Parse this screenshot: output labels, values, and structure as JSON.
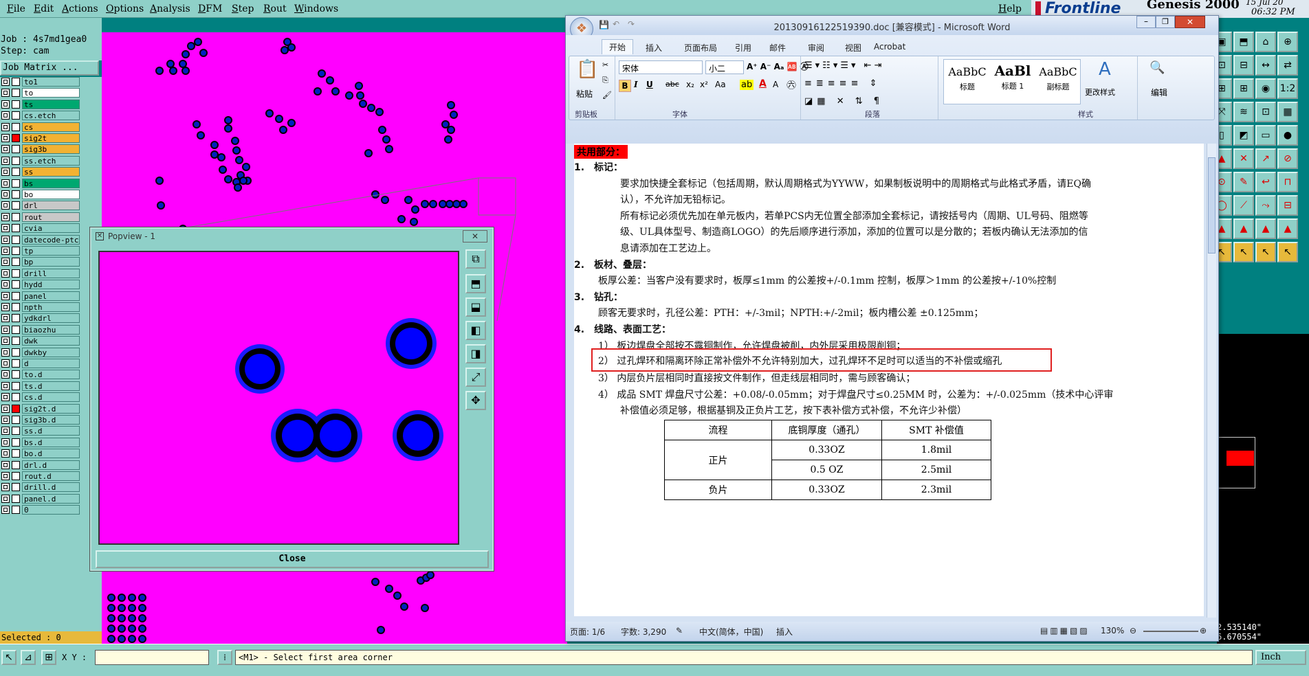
{
  "genesis": {
    "menu": [
      "File",
      "Edit",
      "Actions",
      "Options",
      "Analysis",
      "DFM",
      "Step",
      "Rout",
      "Windows"
    ],
    "help": "Help",
    "brand": "Frontline",
    "product": "Genesis 2000",
    "date": "15 Jul 20",
    "time": "06:32 PM",
    "job_label": "Job : 4s7md1gea0",
    "step_label": "Step: cam",
    "job_matrix": "Job Matrix ...",
    "selected": "Selected : 0",
    "coords": {
      "x": "2.535140\"",
      "y": "6.670554\""
    },
    "xy_label": "X Y :",
    "xy_value": "",
    "prompt": "<M1> - Select first area corner",
    "units": "Inch",
    "layers": [
      {
        "name": "to1",
        "color": "#8fd0c8",
        "sel": false
      },
      {
        "name": "to",
        "color": "#ffffff",
        "sel": false
      },
      {
        "name": "ts",
        "color": "#00a870",
        "sel": false
      },
      {
        "name": "cs.etch",
        "color": "#8fd0c8",
        "sel": false
      },
      {
        "name": "cs",
        "color": "#f2b233",
        "sel": false
      },
      {
        "name": "sig2t",
        "color": "#f2b233",
        "sel": true
      },
      {
        "name": "sig3b",
        "color": "#f2b233",
        "sel": false
      },
      {
        "name": "ss.etch",
        "color": "#8fd0c8",
        "sel": false
      },
      {
        "name": "ss",
        "color": "#f2b233",
        "sel": false
      },
      {
        "name": "bs",
        "color": "#00a870",
        "sel": false
      },
      {
        "name": "bo",
        "color": "#ffffff",
        "sel": false
      },
      {
        "name": "drl",
        "color": "#c8c8c8",
        "sel": false
      },
      {
        "name": "rout",
        "color": "#c8c8c8",
        "sel": false
      },
      {
        "name": "cvia",
        "color": "#8fd0c8",
        "sel": false
      },
      {
        "name": "datecode-ptc",
        "color": "#8fd0c8",
        "sel": false
      },
      {
        "name": "tp",
        "color": "#8fd0c8",
        "sel": false
      },
      {
        "name": "bp",
        "color": "#8fd0c8",
        "sel": false
      },
      {
        "name": "drill",
        "color": "#8fd0c8",
        "sel": false
      },
      {
        "name": "hydd",
        "color": "#8fd0c8",
        "sel": false
      },
      {
        "name": "panel",
        "color": "#8fd0c8",
        "sel": false
      },
      {
        "name": "npth",
        "color": "#8fd0c8",
        "sel": false
      },
      {
        "name": "ydkdrl",
        "color": "#8fd0c8",
        "sel": false
      },
      {
        "name": "biaozhu",
        "color": "#8fd0c8",
        "sel": false
      },
      {
        "name": "dwk",
        "color": "#8fd0c8",
        "sel": false
      },
      {
        "name": "dwkby",
        "color": "#8fd0c8",
        "sel": false
      },
      {
        "name": "d",
        "color": "#8fd0c8",
        "sel": false
      },
      {
        "name": "to.d",
        "color": "#8fd0c8",
        "sel": false
      },
      {
        "name": "ts.d",
        "color": "#8fd0c8",
        "sel": false
      },
      {
        "name": "cs.d",
        "color": "#8fd0c8",
        "sel": false
      },
      {
        "name": "sig2t.d",
        "color": "#8fd0c8",
        "sel": true
      },
      {
        "name": "sig3b.d",
        "color": "#8fd0c8",
        "sel": false
      },
      {
        "name": "ss.d",
        "color": "#8fd0c8",
        "sel": false
      },
      {
        "name": "bs.d",
        "color": "#8fd0c8",
        "sel": false
      },
      {
        "name": "bo.d",
        "color": "#8fd0c8",
        "sel": false
      },
      {
        "name": "drl.d",
        "color": "#8fd0c8",
        "sel": false
      },
      {
        "name": "rout.d",
        "color": "#8fd0c8",
        "sel": false
      },
      {
        "name": "drill.d",
        "color": "#8fd0c8",
        "sel": false
      },
      {
        "name": "panel.d",
        "color": "#8fd0c8",
        "sel": false
      },
      {
        "name": "0",
        "color": "#8fd0c8",
        "sel": false
      }
    ]
  },
  "popview": {
    "title": "Popview - 1",
    "close": "Close"
  },
  "word": {
    "title": "20130916122519390.doc [兼容模式] - Microsoft Word",
    "tabs": [
      "开始",
      "插入",
      "页面布局",
      "引用",
      "邮件",
      "审阅",
      "视图",
      "Acrobat"
    ],
    "font": "宋体",
    "size": "小二",
    "groups": {
      "clipboard": "剪贴板",
      "font": "字体",
      "paragraph": "段落",
      "styles": "样式"
    },
    "paste": "粘贴",
    "styles": [
      {
        "sample": "AaBbC",
        "name": "标题"
      },
      {
        "sample": "AaBl",
        "name": "标题 1"
      },
      {
        "sample": "AaBbC",
        "name": "副标题"
      }
    ],
    "change_styles": "更改样式",
    "edit": "编辑",
    "status": {
      "page": "页面: 1/6",
      "words": "字数: 3,290",
      "lang": "中文(简体，中国)",
      "mode": "插入",
      "zoom": "130%"
    },
    "doc": {
      "heading": "共用部分：",
      "s1": "1. 标记：",
      "s1a": "要求加快捷全套标记（包括周期，默认周期格式为YYWW，如果制板说明中的周期格式与此格式矛盾，请EQ确",
      "s1b": "认），不允许加无铅标记。",
      "s1c": "所有标记必须优先加在单元板内，若单PCS内无位置全部添加全套标记，请按括号内（周期、UL号码、阻燃等",
      "s1d": "级、UL具体型号、制造商LOGO）的先后顺序进行添加，添加的位置可以是分散的；若板内确认无法添加的信",
      "s1e": "息请添加在工艺边上。",
      "s2": "2. 板材、叠层：",
      "s2a": "板厚公差：当客户没有要求时，板厚≤1mm 的公差按+/-0.1mm 控制，板厚＞1mm 的公差按+/-10%控制",
      "s3": "3. 钻孔：",
      "s3a": "顾客无要求时，孔径公差：PTH：+/-3mil；NPTH:+/-2mil；板内槽公差 ±0.125mm；",
      "s4": "4. 线路、表面工艺：",
      "s4a": "1） 板边焊盘全部按不露铜制作，允许焊盘被削，内外层采用极限削铜；",
      "s4b": "2） 过孔焊环和隔离环除正常补偿外不允许特别加大，过孔焊环不足时可以适当的不补偿或缩孔",
      "s4c": "3） 内层负片层相同时直接按文件制作，但走线层相同时，需与顾客确认；",
      "s4d": "4） 成品 SMT 焊盘尺寸公差：+0.08/-0.05mm；对于焊盘尺寸≤0.25MM 时，公差为：+/-0.025mm（技术中心评审",
      "s4e": "补偿值必须足够，根据基铜及正负片工艺，按下表补偿方式补偿，不允许少补偿）",
      "table": {
        "headers": [
          "流程",
          "底铜厚度（通孔）",
          "SMT 补偿值"
        ],
        "r1": [
          "正片",
          "0.33OZ",
          "1.8mil"
        ],
        "r2": [
          "",
          "0.5 OZ",
          "2.5mil"
        ],
        "r3": [
          "负片",
          "0.33OZ",
          "2.3mil"
        ]
      }
    }
  }
}
